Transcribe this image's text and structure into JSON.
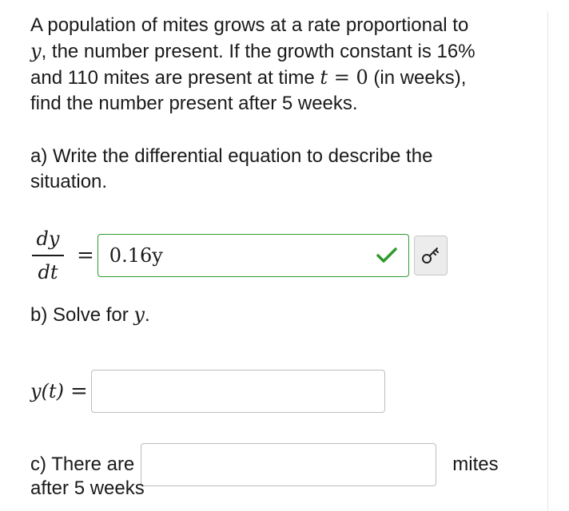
{
  "problem": {
    "line1": "A population of mites grows at a rate proportional to",
    "line2_var": "y",
    "line2_rest": ", the number present. If the growth constant is 16%",
    "line3_pre": "and 110 mites are present at time ",
    "line3_t": "t",
    "line3_eq": " = 0",
    "line3_post": " (in weeks),",
    "line4": "find the number present after 5 weeks."
  },
  "part_a": {
    "prompt_line1": "a) Write the differential equation to describe the",
    "prompt_line2": "situation.",
    "lhs_numerator": "dy",
    "lhs_denominator": "dt",
    "equals": "=",
    "answer_value": "0.16y",
    "answer_status": "correct",
    "colors": {
      "correct_border": "#2e9a2e",
      "check": "#2e9a2e"
    },
    "key_icon": "key-icon"
  },
  "part_b": {
    "prompt_pre": "b) Solve for ",
    "prompt_var": "y",
    "prompt_post": ".",
    "lhs": "y(t)",
    "equals": "=",
    "answer_value": ""
  },
  "part_c": {
    "lead": "c) There are",
    "unit": "mites",
    "tail": "after 5 weeks",
    "answer_value": ""
  }
}
